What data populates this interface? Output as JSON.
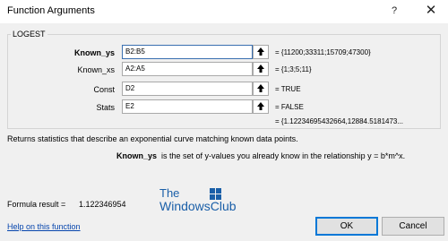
{
  "window": {
    "title": "Function Arguments",
    "help_glyph": "?",
    "close_glyph": "✕"
  },
  "function_name": "LOGEST",
  "arguments": [
    {
      "label": "Known_ys",
      "value": "B2:B5",
      "result": "=  {11200;33311;15709;47300}"
    },
    {
      "label": "Known_xs",
      "value": "A2:A5",
      "result": "=  {1;3;5;11}"
    },
    {
      "label": "Const",
      "value": "D2",
      "result": "=  TRUE"
    },
    {
      "label": "Stats",
      "value": "E2",
      "result": "=  FALSE"
    }
  ],
  "result_line": "=  {1.12234695432664,12884.5181473...",
  "description": "Returns statistics that describe an exponential curve matching known data points.",
  "arg_help": {
    "name": "Known_ys",
    "text": "is the set of y-values you already know in the relationship y = b*m^x."
  },
  "formula_result": {
    "label": "Formula result =",
    "value": "1.122346954"
  },
  "help_link": "Help on this function",
  "buttons": {
    "ok": "OK",
    "cancel": "Cancel"
  },
  "watermark": {
    "line1": "The",
    "line2": "WindowsClub"
  },
  "colors": {
    "accent": "#0078d7",
    "link": "#0645ad",
    "watermark": "#1a5fa8"
  },
  "icons": [
    "help-icon",
    "close-icon",
    "collapse-dialog-icon"
  ]
}
